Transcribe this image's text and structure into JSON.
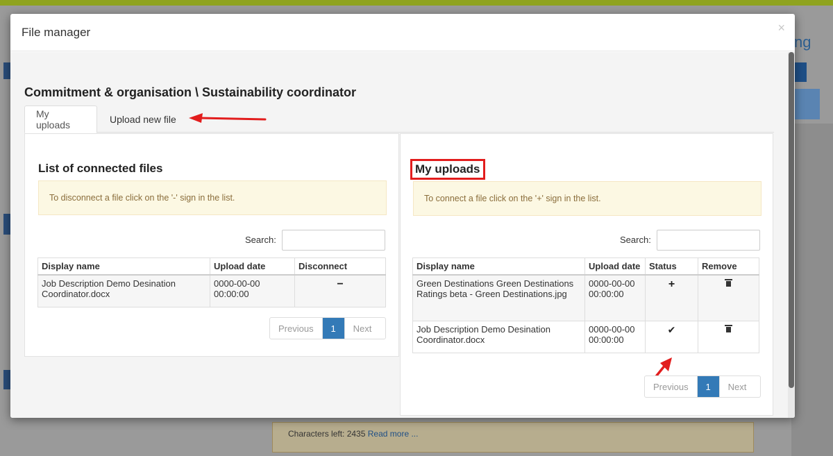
{
  "background": {
    "title_fragment": "ng",
    "textbox_text": "Characters left: 2435",
    "textbox_link": "Read more ..."
  },
  "modal": {
    "title": "File manager",
    "close_glyph": "×",
    "heading": "Commitment & organisation \\ Sustainability coordinator",
    "tabs": [
      {
        "label": "My uploads",
        "active": true
      },
      {
        "label": "Upload new file",
        "active": false
      }
    ]
  },
  "connected_files": {
    "title": "List of connected files",
    "info": "To disconnect a file click on the '-' sign in the list.",
    "search_label": "Search:",
    "search_value": "",
    "columns": [
      "Display name",
      "Upload date",
      "Disconnect"
    ],
    "rows": [
      {
        "name": "Job Description Demo Desination Coordinator.docx",
        "date": "0000-00-00 00:00:00",
        "action": "−"
      }
    ],
    "pager": {
      "previous": "Previous",
      "page": "1",
      "next": "Next"
    }
  },
  "my_uploads": {
    "title": "My uploads",
    "info": "To connect a file click on the '+' sign in the list.",
    "search_label": "Search:",
    "search_value": "",
    "columns": [
      "Display name",
      "Upload date",
      "Status",
      "Remove"
    ],
    "rows": [
      {
        "name": "Green Destinations Green Destinations Ratings beta - Green Destinations.jpg",
        "date": "0000-00-00 00:00:00",
        "status": "+",
        "remove_icon": "trash-icon"
      },
      {
        "name": "Job Description Demo Desination Coordinator.docx",
        "date": "0000-00-00 00:00:00",
        "status": "✔",
        "remove_icon": "trash-icon"
      }
    ],
    "pager": {
      "previous": "Previous",
      "page": "1",
      "next": "Next"
    }
  },
  "colors": {
    "accent": "#337ab7",
    "annotation_red": "#e21d1d",
    "info_bg": "#fcf8e3",
    "outer_green": "#8fa31f"
  }
}
